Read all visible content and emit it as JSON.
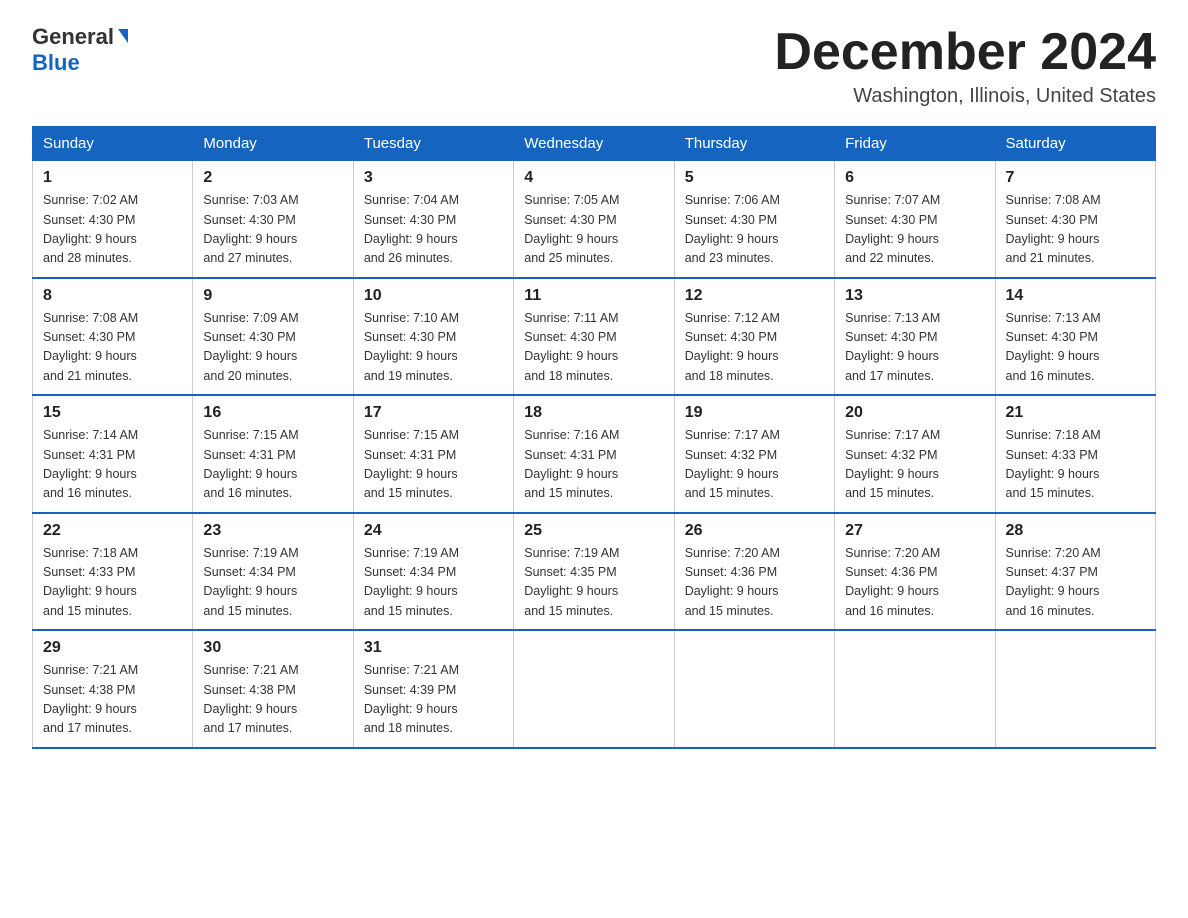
{
  "logo": {
    "general": "General",
    "blue": "Blue"
  },
  "header": {
    "month": "December 2024",
    "location": "Washington, Illinois, United States"
  },
  "weekdays": [
    "Sunday",
    "Monday",
    "Tuesday",
    "Wednesday",
    "Thursday",
    "Friday",
    "Saturday"
  ],
  "weeks": [
    [
      {
        "day": "1",
        "sunrise": "7:02 AM",
        "sunset": "4:30 PM",
        "daylight": "9 hours and 28 minutes."
      },
      {
        "day": "2",
        "sunrise": "7:03 AM",
        "sunset": "4:30 PM",
        "daylight": "9 hours and 27 minutes."
      },
      {
        "day": "3",
        "sunrise": "7:04 AM",
        "sunset": "4:30 PM",
        "daylight": "9 hours and 26 minutes."
      },
      {
        "day": "4",
        "sunrise": "7:05 AM",
        "sunset": "4:30 PM",
        "daylight": "9 hours and 25 minutes."
      },
      {
        "day": "5",
        "sunrise": "7:06 AM",
        "sunset": "4:30 PM",
        "daylight": "9 hours and 23 minutes."
      },
      {
        "day": "6",
        "sunrise": "7:07 AM",
        "sunset": "4:30 PM",
        "daylight": "9 hours and 22 minutes."
      },
      {
        "day": "7",
        "sunrise": "7:08 AM",
        "sunset": "4:30 PM",
        "daylight": "9 hours and 21 minutes."
      }
    ],
    [
      {
        "day": "8",
        "sunrise": "7:08 AM",
        "sunset": "4:30 PM",
        "daylight": "9 hours and 21 minutes."
      },
      {
        "day": "9",
        "sunrise": "7:09 AM",
        "sunset": "4:30 PM",
        "daylight": "9 hours and 20 minutes."
      },
      {
        "day": "10",
        "sunrise": "7:10 AM",
        "sunset": "4:30 PM",
        "daylight": "9 hours and 19 minutes."
      },
      {
        "day": "11",
        "sunrise": "7:11 AM",
        "sunset": "4:30 PM",
        "daylight": "9 hours and 18 minutes."
      },
      {
        "day": "12",
        "sunrise": "7:12 AM",
        "sunset": "4:30 PM",
        "daylight": "9 hours and 18 minutes."
      },
      {
        "day": "13",
        "sunrise": "7:13 AM",
        "sunset": "4:30 PM",
        "daylight": "9 hours and 17 minutes."
      },
      {
        "day": "14",
        "sunrise": "7:13 AM",
        "sunset": "4:30 PM",
        "daylight": "9 hours and 16 minutes."
      }
    ],
    [
      {
        "day": "15",
        "sunrise": "7:14 AM",
        "sunset": "4:31 PM",
        "daylight": "9 hours and 16 minutes."
      },
      {
        "day": "16",
        "sunrise": "7:15 AM",
        "sunset": "4:31 PM",
        "daylight": "9 hours and 16 minutes."
      },
      {
        "day": "17",
        "sunrise": "7:15 AM",
        "sunset": "4:31 PM",
        "daylight": "9 hours and 15 minutes."
      },
      {
        "day": "18",
        "sunrise": "7:16 AM",
        "sunset": "4:31 PM",
        "daylight": "9 hours and 15 minutes."
      },
      {
        "day": "19",
        "sunrise": "7:17 AM",
        "sunset": "4:32 PM",
        "daylight": "9 hours and 15 minutes."
      },
      {
        "day": "20",
        "sunrise": "7:17 AM",
        "sunset": "4:32 PM",
        "daylight": "9 hours and 15 minutes."
      },
      {
        "day": "21",
        "sunrise": "7:18 AM",
        "sunset": "4:33 PM",
        "daylight": "9 hours and 15 minutes."
      }
    ],
    [
      {
        "day": "22",
        "sunrise": "7:18 AM",
        "sunset": "4:33 PM",
        "daylight": "9 hours and 15 minutes."
      },
      {
        "day": "23",
        "sunrise": "7:19 AM",
        "sunset": "4:34 PM",
        "daylight": "9 hours and 15 minutes."
      },
      {
        "day": "24",
        "sunrise": "7:19 AM",
        "sunset": "4:34 PM",
        "daylight": "9 hours and 15 minutes."
      },
      {
        "day": "25",
        "sunrise": "7:19 AM",
        "sunset": "4:35 PM",
        "daylight": "9 hours and 15 minutes."
      },
      {
        "day": "26",
        "sunrise": "7:20 AM",
        "sunset": "4:36 PM",
        "daylight": "9 hours and 15 minutes."
      },
      {
        "day": "27",
        "sunrise": "7:20 AM",
        "sunset": "4:36 PM",
        "daylight": "9 hours and 16 minutes."
      },
      {
        "day": "28",
        "sunrise": "7:20 AM",
        "sunset": "4:37 PM",
        "daylight": "9 hours and 16 minutes."
      }
    ],
    [
      {
        "day": "29",
        "sunrise": "7:21 AM",
        "sunset": "4:38 PM",
        "daylight": "9 hours and 17 minutes."
      },
      {
        "day": "30",
        "sunrise": "7:21 AM",
        "sunset": "4:38 PM",
        "daylight": "9 hours and 17 minutes."
      },
      {
        "day": "31",
        "sunrise": "7:21 AM",
        "sunset": "4:39 PM",
        "daylight": "9 hours and 18 minutes."
      },
      null,
      null,
      null,
      null
    ]
  ],
  "labels": {
    "sunrise": "Sunrise:",
    "sunset": "Sunset:",
    "daylight": "Daylight:"
  }
}
